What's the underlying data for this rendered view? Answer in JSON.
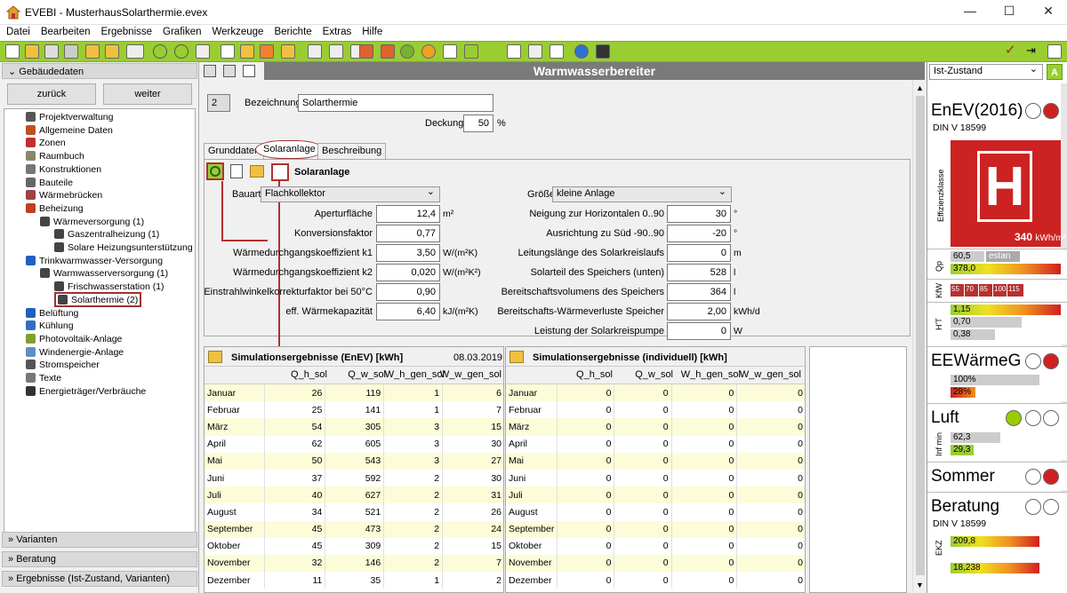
{
  "window": {
    "title": "EVEBI - MusterhausSolarthermie.evex"
  },
  "menu": [
    "Datei",
    "Bearbeiten",
    "Ergebnisse",
    "Grafiken",
    "Werkzeuge",
    "Berichte",
    "Extras",
    "Hilfe"
  ],
  "left": {
    "section_title": "Gebäudedaten",
    "back_label": "zurück",
    "next_label": "weiter",
    "tree": [
      {
        "label": "Projektverwaltung",
        "level": 0
      },
      {
        "label": "Allgemeine Daten",
        "level": 0
      },
      {
        "label": "Zonen",
        "level": 0
      },
      {
        "label": "Raumbuch",
        "level": 0
      },
      {
        "label": "Konstruktionen",
        "level": 0
      },
      {
        "label": "Bauteile",
        "level": 0
      },
      {
        "label": "Wärmebrücken",
        "level": 0
      },
      {
        "label": "Beheizung",
        "level": 0
      },
      {
        "label": "Wärmeversorgung (1)",
        "level": 1
      },
      {
        "label": "Gaszentralheizung (1)",
        "level": 2
      },
      {
        "label": "Solare Heizungsunterstützung (",
        "level": 2
      },
      {
        "label": "Trinkwarmwasser-Versorgung",
        "level": 0
      },
      {
        "label": "Warmwasserversorgung (1)",
        "level": 1
      },
      {
        "label": "Frischwasserstation (1)",
        "level": 2
      },
      {
        "label": "Solarthermie (2)",
        "level": 2
      },
      {
        "label": "Belüftung",
        "level": 0
      },
      {
        "label": "Kühlung",
        "level": 0
      },
      {
        "label": "Photovoltaik-Anlage",
        "level": 0
      },
      {
        "label": "Windenergie-Anlage",
        "level": 0
      },
      {
        "label": "Stromspeicher",
        "level": 0
      },
      {
        "label": "Texte",
        "level": 0
      },
      {
        "label": "Energieträger/Verbräuche",
        "level": 0
      }
    ],
    "bottom_sections": [
      "Varianten",
      "Beratung",
      "Ergebnisse (Ist-Zustand, Varianten)"
    ]
  },
  "main": {
    "title": "Warmwasserbereiter",
    "number": "2",
    "bezeichnung_label": "Bezeichnung",
    "bezeichnung_value": "Solarthermie",
    "deckung_label": "Deckung",
    "deckung_value": "50",
    "deckung_unit": "%",
    "tabs": [
      "Grunddaten",
      "Solaranlage",
      "Beschreibung"
    ],
    "solar_title": "Solaranlage",
    "bauart_label": "Bauart",
    "bauart_value": "Flachkollektor",
    "groesse_label": "Größe",
    "groesse_value": "kleine Anlage",
    "left_fields": [
      {
        "label": "Aperturfläche",
        "value": "12,4",
        "unit": "m²"
      },
      {
        "label": "Konversionsfaktor",
        "value": "0,77",
        "unit": ""
      },
      {
        "label": "Wärmedurchgangskoeffizient k1",
        "value": "3,50",
        "unit": "W/(m²K)"
      },
      {
        "label": "Wärmedurchgangskoeffizient k2",
        "value": "0,020",
        "unit": "W/(m²K²)"
      },
      {
        "label": "Einstrahlwinkelkorrekturfaktor bei 50°C",
        "value": "0,90",
        "unit": ""
      },
      {
        "label": "eff. Wärmekapazität",
        "value": "6,40",
        "unit": "kJ/(m²K)"
      }
    ],
    "right_fields": [
      {
        "label": "Neigung zur Horizontalen 0..90",
        "value": "30",
        "unit": "°"
      },
      {
        "label": "Ausrichtung zu Süd -90..90",
        "value": "-20",
        "unit": "°"
      },
      {
        "label": "Leitungslänge des Solarkreislaufs",
        "value": "0",
        "unit": "m"
      },
      {
        "label": "Solarteil des Speichers (unten)",
        "value": "528",
        "unit": "l"
      },
      {
        "label": "Bereitschaftsvolumens des Speichers",
        "value": "364",
        "unit": "l"
      },
      {
        "label": "Bereitschafts-Wärmeverluste Speicher",
        "value": "2,00",
        "unit": "kWh/d"
      },
      {
        "label": "Leistung der Solarkreispumpe",
        "value": "0",
        "unit": "W"
      }
    ],
    "sim1": {
      "title": "Simulationsergebnisse (EnEV) [kWh]",
      "date": "08.03.2019",
      "columns": [
        "Q_h_sol",
        "Q_w_sol",
        "W_h_gen_sol",
        "W_w_gen_sol"
      ],
      "rows": [
        [
          "Januar",
          "26",
          "119",
          "1",
          "6"
        ],
        [
          "Februar",
          "25",
          "141",
          "1",
          "7"
        ],
        [
          "März",
          "54",
          "305",
          "3",
          "15"
        ],
        [
          "April",
          "62",
          "605",
          "3",
          "30"
        ],
        [
          "Mai",
          "50",
          "543",
          "3",
          "27"
        ],
        [
          "Juni",
          "37",
          "592",
          "2",
          "30"
        ],
        [
          "Juli",
          "40",
          "627",
          "2",
          "31"
        ],
        [
          "August",
          "34",
          "521",
          "2",
          "26"
        ],
        [
          "September",
          "45",
          "473",
          "2",
          "24"
        ],
        [
          "Oktober",
          "45",
          "309",
          "2",
          "15"
        ],
        [
          "November",
          "32",
          "146",
          "2",
          "7"
        ],
        [
          "Dezember",
          "11",
          "35",
          "1",
          "2"
        ]
      ]
    },
    "sim2": {
      "title": "Simulationsergebnisse (individuell) [kWh]",
      "columns": [
        "Q_h_sol",
        "Q_w_sol",
        "W_h_gen_sol",
        "W_w_gen_sol"
      ],
      "rows": [
        [
          "Januar",
          "0",
          "0",
          "0",
          "0"
        ],
        [
          "Februar",
          "0",
          "0",
          "0",
          "0"
        ],
        [
          "März",
          "0",
          "0",
          "0",
          "0"
        ],
        [
          "April",
          "0",
          "0",
          "0",
          "0"
        ],
        [
          "Mai",
          "0",
          "0",
          "0",
          "0"
        ],
        [
          "Juni",
          "0",
          "0",
          "0",
          "0"
        ],
        [
          "Juli",
          "0",
          "0",
          "0",
          "0"
        ],
        [
          "August",
          "0",
          "0",
          "0",
          "0"
        ],
        [
          "September",
          "0",
          "0",
          "0",
          "0"
        ],
        [
          "Oktober",
          "0",
          "0",
          "0",
          "0"
        ],
        [
          "November",
          "0",
          "0",
          "0",
          "0"
        ],
        [
          "Dezember",
          "0",
          "0",
          "0",
          "0"
        ]
      ]
    }
  },
  "right": {
    "state_select": "Ist-Zustand",
    "a_badge": "A",
    "enev_title": "EnEV(2016)",
    "enev_sub": "DIN V 18599",
    "eff_label": "Effizienzklasse",
    "eff_letter": "H",
    "eff_value": "340",
    "eff_unit": "kWh/m²",
    "qp_label": "Qp",
    "qp_val1": "60,5",
    "qp_val1_extra": "estan",
    "qp_val2": "378,0",
    "kfw_label": "KfW",
    "kfw_values": [
      "55",
      "70",
      "85",
      "100",
      "115"
    ],
    "ht_label": "H'T",
    "ht_vals": [
      "1,15",
      "0,70",
      "0,38"
    ],
    "eew_title": "EEWärmeG",
    "eew_vals": [
      "100%",
      "28%"
    ],
    "luft_title": "Luft",
    "luft_label": "Inf min",
    "luft_vals": [
      "62,3",
      "29,3"
    ],
    "sommer_title": "Sommer",
    "beratung_title": "Beratung",
    "beratung_sub": "DIN V 18599",
    "ekz_label": "EKZ",
    "ekz_vals": [
      "209,8",
      "18,238"
    ],
    "colors": {
      "green": "#9acd32",
      "red": "#cc2222",
      "circle_red": "#d02020",
      "circle_green": "#99cc00"
    }
  }
}
